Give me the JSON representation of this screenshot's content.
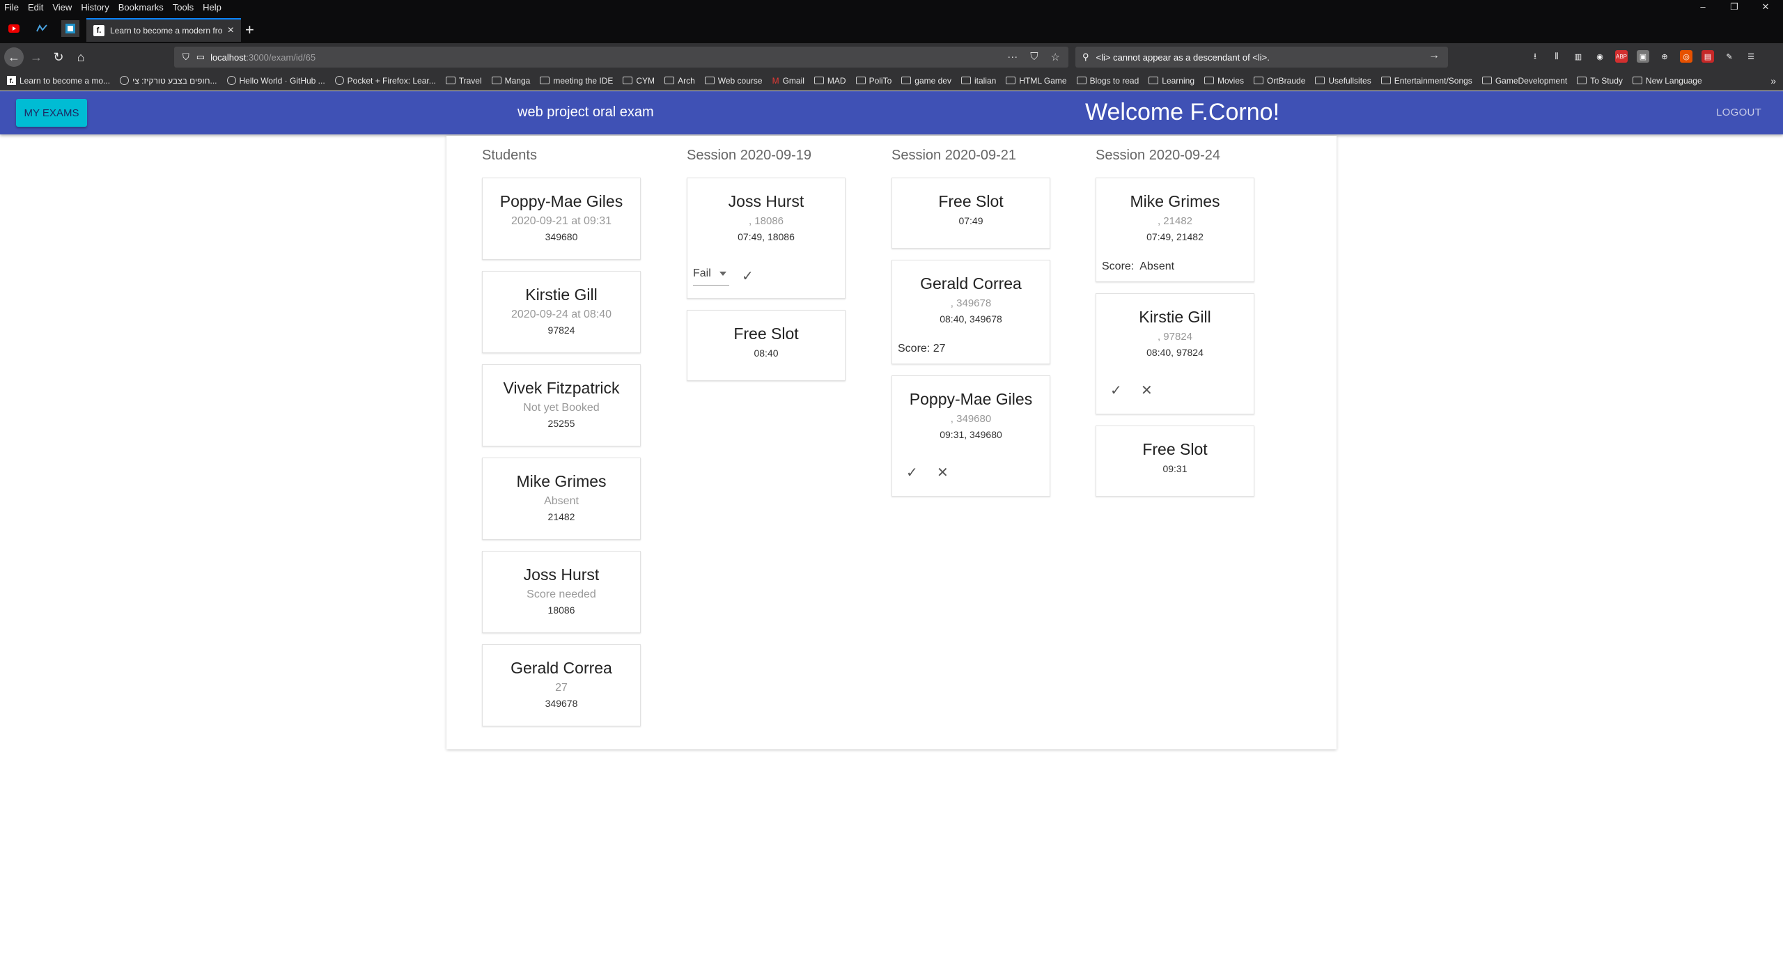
{
  "browser": {
    "menu": [
      "File",
      "Edit",
      "View",
      "History",
      "Bookmarks",
      "Tools",
      "Help"
    ],
    "window_controls": [
      "–",
      "❐",
      "✕"
    ],
    "tab_title": "Learn to become a modern fro",
    "url_host": "localhost",
    "url_path": ":3000/exam/id/65",
    "search_text": "<li> cannot appear as a descendant of <li>.",
    "bookmarks": [
      "Learn to become a mo...",
      "חופים בצבע טורקיז: צי...",
      "Hello World · GitHub ...",
      "Pocket + Firefox: Lear...",
      "Travel",
      "Manga",
      "meeting the IDE",
      "CYM",
      "Arch",
      "Web course",
      "Gmail",
      "MAD",
      "PoliTo",
      "game dev",
      "italian",
      "HTML Game",
      "Blogs to read",
      "Learning",
      "Movies",
      "OrtBraude",
      "Usefullsites",
      "Entertainment/Songs",
      "GameDevelopment",
      "To Study",
      "New Language"
    ]
  },
  "app": {
    "my_exams": "MY EXAMS",
    "exam_name": "web project oral exam",
    "welcome": "Welcome F.Corno!",
    "logout": "LOGOUT"
  },
  "columns": {
    "students": "Students",
    "s1": "Session 2020-09-19",
    "s2": "Session 2020-09-21",
    "s3": "Session 2020-09-24"
  },
  "students": [
    {
      "name": "Poppy-Mae Giles",
      "status": "2020-09-21 at 09:31",
      "id": "349680"
    },
    {
      "name": "Kirstie Gill",
      "status": "2020-09-24 at 08:40",
      "id": "97824"
    },
    {
      "name": "Vivek Fitzpatrick",
      "status": "Not yet Booked",
      "id": "25255"
    },
    {
      "name": "Mike Grimes",
      "status": "Absent",
      "id": "21482"
    },
    {
      "name": "Joss Hurst",
      "status": "Score needed",
      "id": "18086"
    },
    {
      "name": "Gerald Correa",
      "status": "27",
      "id": "349678"
    }
  ],
  "session1": [
    {
      "name": "Joss Hurst",
      "sub": ", 18086",
      "time": "07:49, 18086",
      "select_value": "Fail"
    },
    {
      "name": "Free Slot",
      "time": "08:40"
    }
  ],
  "session2": [
    {
      "name": "Free Slot",
      "time": "07:49"
    },
    {
      "name": "Gerald Correa",
      "sub": ", 349678",
      "time": "08:40, 349678",
      "score": "Score: 27"
    },
    {
      "name": "Poppy-Mae Giles",
      "sub": ", 349680",
      "time": "09:31, 349680"
    }
  ],
  "session3": [
    {
      "name": "Mike Grimes",
      "sub": ", 21482",
      "time": "07:49, 21482",
      "score": "Score:  Absent"
    },
    {
      "name": "Kirstie Gill",
      "sub": ", 97824",
      "time": "08:40, 97824"
    },
    {
      "name": "Free Slot",
      "time": "09:31"
    }
  ],
  "icons": {
    "check": "✓",
    "close": "✕"
  }
}
